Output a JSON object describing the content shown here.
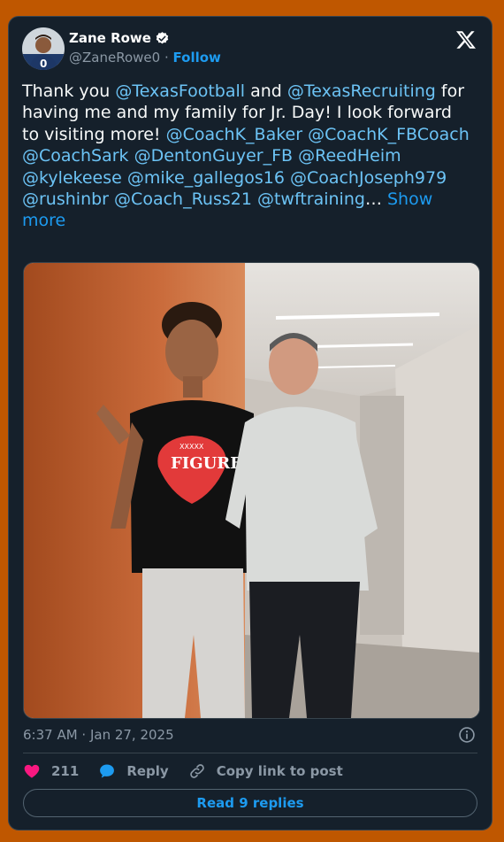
{
  "author": {
    "name": "Zane Rowe",
    "handle": "@ZaneRowe0",
    "separator": "·",
    "follow_label": "Follow",
    "verified_icon": "verified-badge-icon"
  },
  "tweet": {
    "segments": [
      {
        "text": "Thank you ",
        "mention": false
      },
      {
        "text": "@TexasFootball",
        "mention": true
      },
      {
        "text": " and ",
        "mention": false
      },
      {
        "text": "@TexasRecruiting",
        "mention": true
      },
      {
        "text": " for having me and my family for Jr. Day!  I look forward to visiting more! ",
        "mention": false
      },
      {
        "text": "@CoachK_Baker",
        "mention": true
      },
      {
        "text": " ",
        "mention": false
      },
      {
        "text": "@CoachK_FBCoach",
        "mention": true
      },
      {
        "text": " ",
        "mention": false
      },
      {
        "text": "@CoachSark",
        "mention": true
      },
      {
        "text": " ",
        "mention": false
      },
      {
        "text": "@DentonGuyer_FB",
        "mention": true
      },
      {
        "text": " ",
        "mention": false
      },
      {
        "text": "@ReedHeim",
        "mention": true
      },
      {
        "text": " ",
        "mention": false
      },
      {
        "text": "@kylekeese",
        "mention": true
      },
      {
        "text": " ",
        "mention": false
      },
      {
        "text": "@mike_gallegos16",
        "mention": true
      },
      {
        "text": " ",
        "mention": false
      },
      {
        "text": "@CoachJoseph979",
        "mention": true
      },
      {
        "text": " ",
        "mention": false
      },
      {
        "text": "@rushinbr",
        "mention": true
      },
      {
        "text": " ",
        "mention": false
      },
      {
        "text": "@Coach_Russ21",
        "mention": true
      },
      {
        "text": " ",
        "mention": false
      },
      {
        "text": "@twftraining",
        "mention": true
      },
      {
        "text": "… ",
        "mention": false
      }
    ],
    "show_more": "Show more"
  },
  "photo": {
    "shirt_text": "FIGURE",
    "shirt_subtext": "XXXXX"
  },
  "meta": {
    "timestamp": "6:37 AM · Jan 27, 2025"
  },
  "actions": {
    "likes": "211",
    "reply_label": "Reply",
    "copy_label": "Copy link to post",
    "read_replies_label": "Read 9 replies"
  },
  "colors": {
    "page_bg": "#bf5700",
    "card_bg": "#15202b",
    "mention": "#6cc3f5",
    "accent": "#1d9bf0",
    "like": "#f91880"
  }
}
